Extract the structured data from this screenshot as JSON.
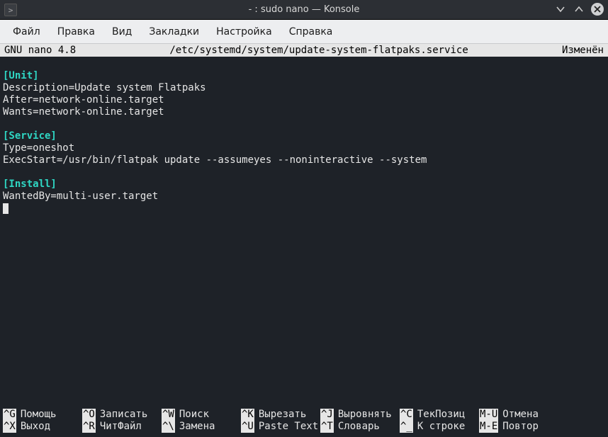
{
  "window": {
    "title": "- : sudo nano — Konsole"
  },
  "menubar": {
    "file": "Файл",
    "edit": "Правка",
    "view": "Вид",
    "bookmarks": "Закладки",
    "settings": "Настройка",
    "help": "Справка"
  },
  "nano_header": {
    "left": "GNU nano 4.8",
    "path": "/etc/systemd/system/update-system-flatpaks.service",
    "status": "Изменён"
  },
  "content": {
    "s1": "[Unit]",
    "l1": "Description=Update system Flatpaks",
    "l2": "After=network-online.target",
    "l3": "Wants=network-online.target",
    "s2": "[Service]",
    "l4": "Type=oneshot",
    "l5": "ExecStart=/usr/bin/flatpak update --assumeyes --noninteractive --system",
    "s3": "[Install]",
    "l6": "WantedBy=multi-user.target"
  },
  "shortcuts": {
    "r1": [
      {
        "key": "^G",
        "label": "Помощь"
      },
      {
        "key": "^O",
        "label": "Записать"
      },
      {
        "key": "^W",
        "label": "Поиск"
      },
      {
        "key": "^K",
        "label": "Вырезать"
      },
      {
        "key": "^J",
        "label": "Выровнять"
      },
      {
        "key": "^C",
        "label": "ТекПозиц"
      },
      {
        "key": "M-U",
        "label": "Отмена"
      }
    ],
    "r2": [
      {
        "key": "^X",
        "label": "Выход"
      },
      {
        "key": "^R",
        "label": "ЧитФайл"
      },
      {
        "key": "^\\",
        "label": "Замена"
      },
      {
        "key": "^U",
        "label": "Paste Text"
      },
      {
        "key": "^T",
        "label": "Словарь"
      },
      {
        "key": "^_",
        "label": "К строке"
      },
      {
        "key": "M-E",
        "label": "Повтор"
      }
    ]
  }
}
